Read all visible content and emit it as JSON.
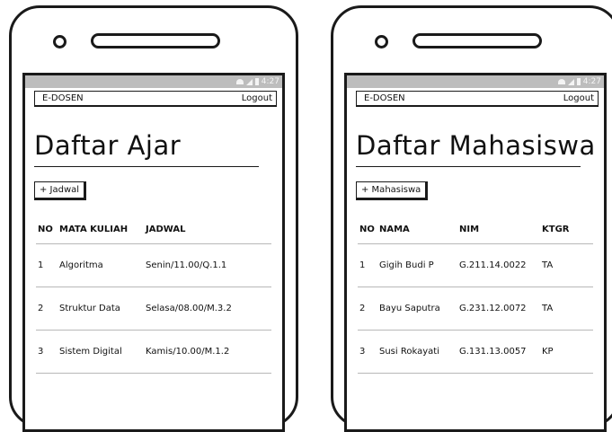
{
  "status_time": "4:27",
  "left": {
    "app_name": "E-DOSEN",
    "logout_label": "Logout",
    "page_title": "Daftar Ajar",
    "add_button": "+ Jadwal",
    "columns": [
      "NO",
      "MATA KULIAH",
      "JADWAL"
    ],
    "rows": [
      [
        "1",
        "Algoritma",
        "Senin/11.00/Q.1.1"
      ],
      [
        "2",
        "Struktur Data",
        "Selasa/08.00/M.3.2"
      ],
      [
        "3",
        "Sistem Digital",
        "Kamis/10.00/M.1.2"
      ]
    ]
  },
  "right": {
    "app_name": "E-DOSEN",
    "logout_label": "Logout",
    "page_title": "Daftar Mahasiswa",
    "add_button": "+ Mahasiswa",
    "columns": [
      "NO",
      "NAMA",
      "NIM",
      "KTGR"
    ],
    "rows": [
      [
        "1",
        "Gigih Budi P",
        "G.211.14.0022",
        "TA"
      ],
      [
        "2",
        "Bayu Saputra",
        "G.231.12.0072",
        "TA"
      ],
      [
        "3",
        "Susi Rokayati",
        "G.131.13.0057",
        "KP"
      ]
    ]
  }
}
